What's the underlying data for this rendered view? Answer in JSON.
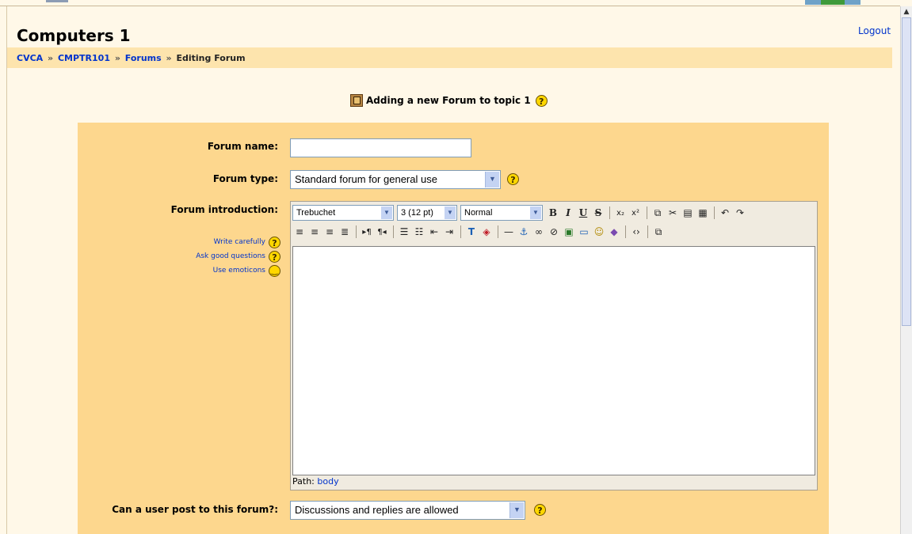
{
  "header": {
    "course_title": "Computers 1",
    "logout_label": "Logout"
  },
  "breadcrumb": {
    "items": [
      "CVCA",
      "CMPTR101",
      "Forums"
    ],
    "separator": "»",
    "current": "Editing Forum"
  },
  "heading": {
    "text": "Adding a new Forum to topic 1",
    "help_icon": "?"
  },
  "form": {
    "forum_name": {
      "label": "Forum name:",
      "value": ""
    },
    "forum_type": {
      "label": "Forum type:",
      "value": "Standard forum for general use"
    },
    "forum_intro": {
      "label": "Forum introduction:",
      "help_links": [
        {
          "label": "Write carefully",
          "icon": "help-icon"
        },
        {
          "label": "Ask good questions",
          "icon": "help-icon"
        },
        {
          "label": "Use emoticons",
          "icon": "smiley-icon"
        }
      ],
      "editor": {
        "font": "Trebuchet",
        "size": "3 (12 pt)",
        "format": "Normal",
        "path_label": "Path:",
        "path_value": "body"
      }
    },
    "post_permission": {
      "label": "Can a user post to this forum?:",
      "value": "Discussions and replies are allowed"
    }
  },
  "colors": {
    "page_bg": "#fff8e8",
    "nav_bg": "#fde4ad",
    "form_bg": "#fdd78e",
    "link": "#0033cc",
    "help_icon": "#ffd700"
  }
}
